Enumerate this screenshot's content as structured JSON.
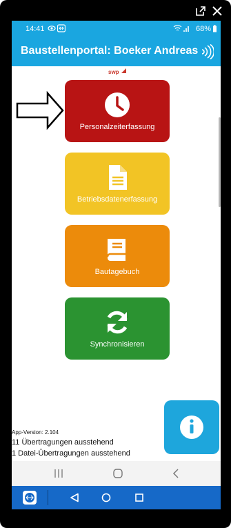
{
  "status_bar": {
    "time": "14:41",
    "battery": "68%"
  },
  "app_bar": {
    "title": "Baustellenportal: Boeker Andreas"
  },
  "logo": "swp",
  "tiles": [
    {
      "label": "Personalzeiterfassung",
      "color": "#b81414",
      "icon": "clock-icon"
    },
    {
      "label": "Betriebsdatenerfassung",
      "color": "#f2c425",
      "icon": "document-icon"
    },
    {
      "label": "Bautagebuch",
      "color": "#ec8b0b",
      "icon": "book-icon"
    },
    {
      "label": "Synchronisieren",
      "color": "#2b9331",
      "icon": "sync-icon"
    }
  ],
  "footer": {
    "app_version": "App-Version: 2.104",
    "pending_transfers": "11 Übertragungen ausstehend",
    "pending_file_transfers": "1 Datei-Übertragungen ausstehend"
  },
  "colors": {
    "accent": "#1aa6e0",
    "teamviewer_bar": "#1669c8"
  }
}
